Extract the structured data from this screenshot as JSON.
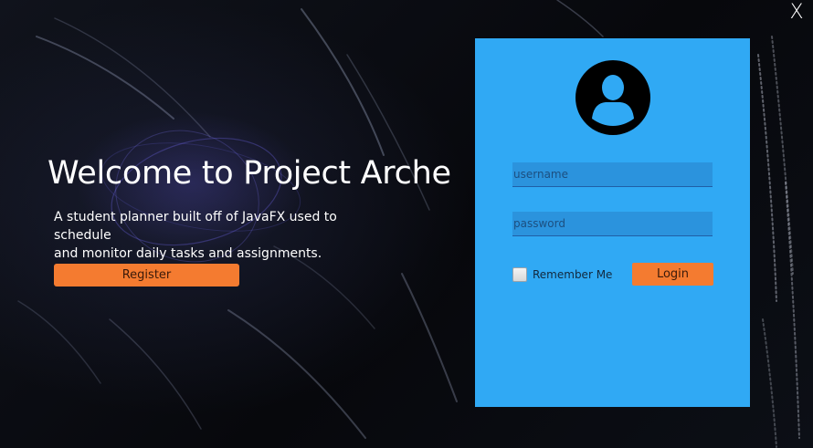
{
  "window": {
    "close_label": "X"
  },
  "welcome": {
    "title": "Welcome to Project Arche",
    "description_line1": "A student planner built off of JavaFX used to schedule",
    "description_line2": "and monitor daily tasks and assignments.",
    "register_label": "Register"
  },
  "login": {
    "avatar_icon": "user-avatar-icon",
    "username_placeholder": "username",
    "password_placeholder": "password",
    "remember_label": "Remember Me",
    "remember_checked": false,
    "login_label": "Login"
  },
  "colors": {
    "panel": "#30a9f4",
    "accent_button": "#f47b30",
    "background": "#0b0d13"
  }
}
